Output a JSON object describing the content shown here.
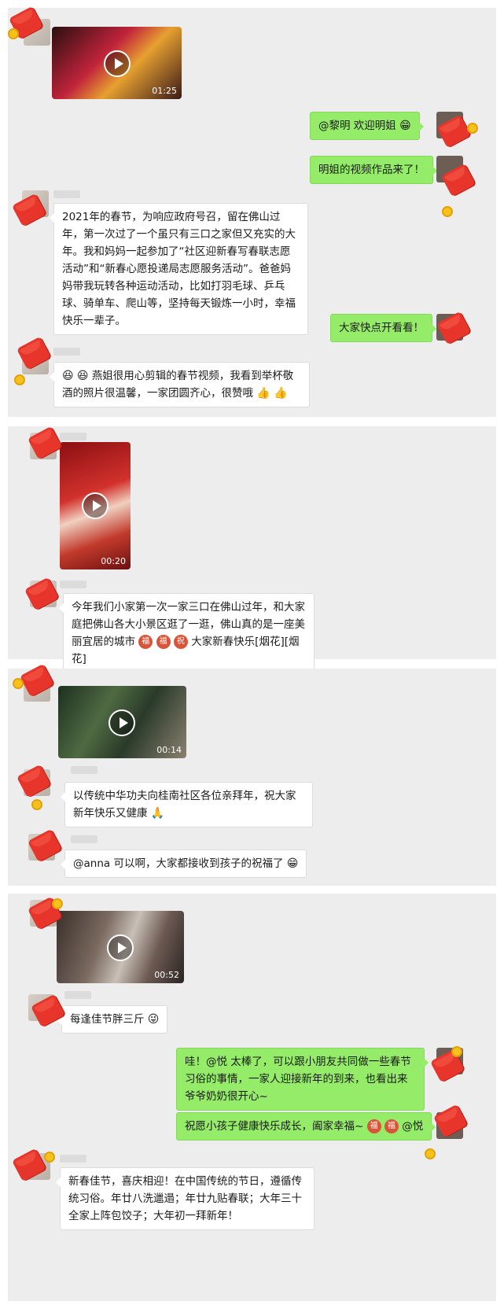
{
  "panel1": {
    "video1_duration": "01:25",
    "msg_welcome": "@黎明  欢迎明姐",
    "msg_video_came": "明姐的视频作品来了！",
    "msg_spring_story": "2021年的春节，为响应政府号召，留在佛山过年，第一次过了一个虽只有三口之家但又充实的大年。我和妈妈一起参加了“社区迎新春写春联志愿活动”和“新春心愿投递局志愿服务活动”。爸爸妈妈带我玩转各种运动活动，比如打羽毛球、乒乓球、骑单车、爬山等，坚持每天锻炼一小时，幸福快乐一辈子。",
    "msg_open_quick": "大家快点开看看！",
    "msg_yanjie": "燕姐很用心剪辑的春节视频，我看到举杯敬酒的照片很温馨，一家团圆齐心，很赞哦"
  },
  "panel2": {
    "video2_duration": "00:20",
    "msg_first_year": "今年我们小家第一次一家三口在佛山过年，和大家庭把佛山各大小景区逛了一逛，佛山真的是一座美丽宜居的城市",
    "msg_first_year_tail": "大家新春快乐[烟花][烟花]",
    "blessing_char": "祝"
  },
  "panel3": {
    "video3_duration": "00:14",
    "msg_kungfu": "以传统中华功夫向桂南社区各位亲拜年，祝大家新年快乐又健康",
    "msg_anna": "@anna 可以啊，大家都接收到孩子的祝福了"
  },
  "panel4": {
    "video4_duration": "00:52",
    "msg_fat": "每逢佳节胖三斤",
    "msg_wow": "哇！@悦 太棒了，可以跟小朋友共同做一些春节习俗的事情，一家人迎接新年的到来，也看出来爷爷奶奶很开心~",
    "msg_wish": "祝愿小孩子健康快乐成长，阖家幸福~",
    "msg_wish_mention": "@悦",
    "msg_new_year": "新春佳节，喜庆相迎！在中国传统的节日，遵循传统习俗。年廿八洗邋遢；年廿九贴春联；大年三十全家上阵包饺子；大年初一拜新年！"
  },
  "icons": {
    "smile": "😁",
    "laugh": "😆",
    "thumb": "👍",
    "fist": "🙏",
    "tongue": "😜"
  },
  "colors": {
    "chat_bg": "#ededed",
    "green_bubble": "#95ec69",
    "red_packet": "#e8352b"
  }
}
